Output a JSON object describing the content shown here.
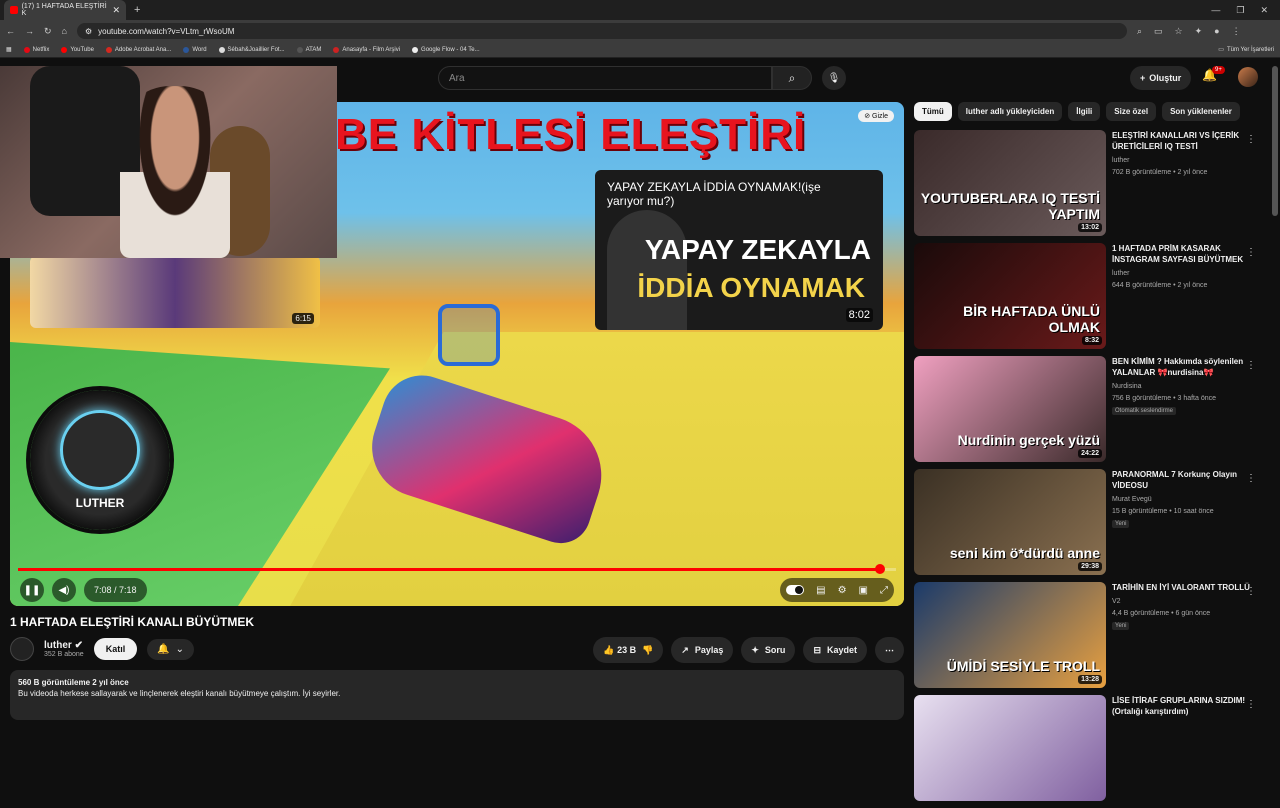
{
  "browser": {
    "tab_title": "(17) 1 HAFTADA ELEŞTİRİ K",
    "url": "youtube.com/watch?v=VLtm_rWsoUM",
    "bookmarks": [
      "Netflix",
      "YouTube",
      "Adobe Acrobat Ana...",
      "Word",
      "Sébah&Joaillier Fot...",
      "ATAM",
      "Anasayfa - Film Arşivi",
      "Google Flow - 04 Te..."
    ],
    "bookmarks_right": "Tüm Yer İşaretleri"
  },
  "header": {
    "search_placeholder": "Ara",
    "create_label": "Oluştur",
    "notif_badge": "9+"
  },
  "player": {
    "overlay_title": "BE KİTLESİ ELEŞTİRİ",
    "hide_label": "Gizle",
    "card_left_duration": "6:15",
    "card_right_title": "YAPAY ZEKAYLA İDDİA OYNAMAK!(işe yarıyor mu?)",
    "card_right_big1": "YAPAY ZEKAYLA",
    "card_right_big2": "İDDİA OYNAMAK",
    "card_right_duration": "8:02",
    "channel_badge": "LUTHER",
    "time": "7:08 / 7:18",
    "progress": 0.982
  },
  "video": {
    "title": "1 HAFTADA ELEŞTİRİ KANALI BÜYÜTMEK",
    "channel": "luther",
    "subs": "352 B abone",
    "join": "Katıl",
    "likes": "23 B",
    "share": "Paylaş",
    "ask": "Soru",
    "save": "Kaydet",
    "views_date": "560 B görüntüleme  2 yıl önce",
    "description": "Bu videoda herkese sallayarak ve linçlenerek eleştiri kanalı büyütmeye çalıştım. İyi seyirler."
  },
  "chips": [
    "Tümü",
    "luther adlı yükleyiciden",
    "İlgili",
    "Size özel",
    "Son yüklenenler"
  ],
  "recs": [
    {
      "title": "ELEŞTİRİ KANALLARI VS İÇERİK ÜRETİCİLERİ IQ TESTİ",
      "channel": "luther",
      "meta": "702 B görüntüleme • 2 yıl önce",
      "duration": "13:02",
      "caption": "YOUTUBERLARA IQ TESTİ YAPTIM",
      "badge": "",
      "color1": "#3a2a2a",
      "color2": "#6a5a5a"
    },
    {
      "title": "1 HAFTADA PRİM KASARAK İNSTAGRAM SAYFASI BÜYÜTMEK",
      "channel": "luther",
      "meta": "644 B görüntüleme • 2 yıl önce",
      "duration": "8:32",
      "caption": "BİR HAFTADA ÜNLÜ OLMAK",
      "badge": "",
      "color1": "#1a0a0a",
      "color2": "#6a1a1a"
    },
    {
      "title": "BEN KİMİM ? Hakkımda söylenilen YALANLAR 🎀nurdisina🎀",
      "channel": "Nurdisina",
      "meta": "756 B görüntüleme • 3 hafta önce",
      "duration": "24:22",
      "caption": "Nurdinin gerçek yüzü",
      "badge": "Otomatik seslendirme",
      "color1": "#f0a0c0",
      "color2": "#3a2a2a"
    },
    {
      "title": "PARANORMAL 7 Korkunç Olayın VİDEOSU",
      "channel": "Murat Evegü",
      "meta": "15 B görüntüleme • 10 saat önce",
      "duration": "29:38",
      "caption": "seni kim ö*dürdü anne",
      "badge": "Yeni",
      "color1": "#3a3024",
      "color2": "#8a7050"
    },
    {
      "title": "TARİHİN EN İYİ VALORANT TROLLÜ",
      "channel": "V2",
      "meta": "4,4 B görüntüleme • 6 gün önce",
      "duration": "13:28",
      "caption": "ÜMİDİ SESİYLE TROLL",
      "badge": "Yeni",
      "color1": "#1a3a6a",
      "color2": "#e8a040"
    },
    {
      "title": "LİSE İTİRAF GRUPLARINA SIZDIM! (Ortalığı karıştırdım)",
      "channel": "",
      "meta": "",
      "duration": "",
      "caption": "",
      "badge": "",
      "color1": "#e8e0f0",
      "color2": "#8060a0"
    }
  ]
}
